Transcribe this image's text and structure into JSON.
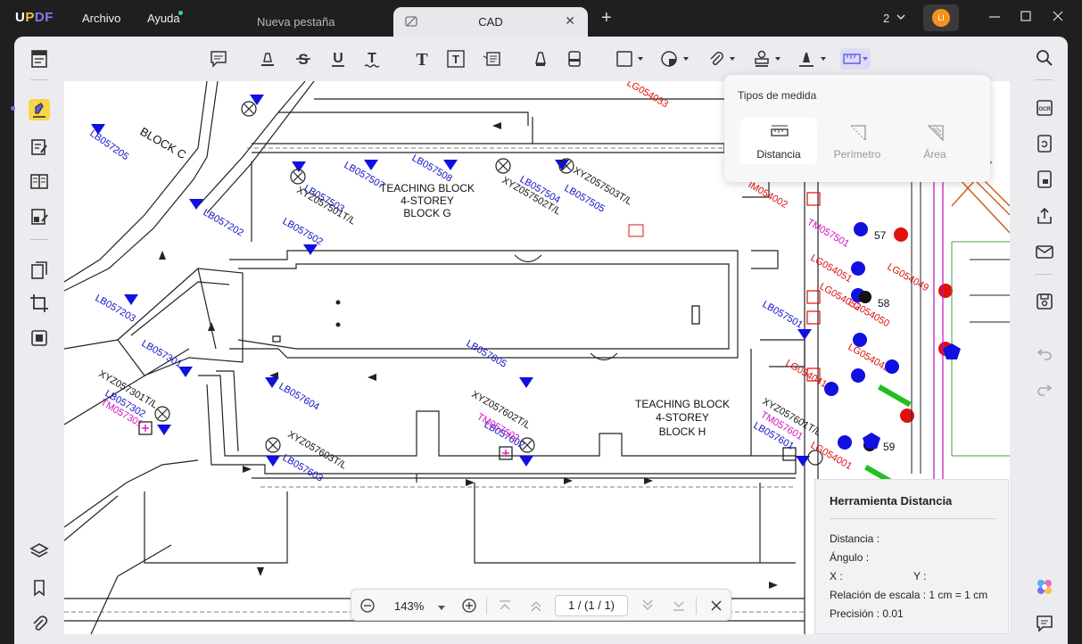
{
  "app": {
    "logo": "UPDF",
    "menu": [
      "Archivo",
      "Ayuda"
    ]
  },
  "tabs": {
    "inactive": "Nueva pestaña",
    "active": "CAD"
  },
  "window": {
    "page_count": "2",
    "avatar": "LI"
  },
  "measure_popup": {
    "title": "Tipos de medida",
    "options": [
      "Distancia",
      "Perímetro",
      "Área"
    ]
  },
  "distance_panel": {
    "title": "Herramienta Distancia",
    "distance": "Distancia :",
    "angle": "Ángulo :",
    "x": "X :",
    "y": "Y :",
    "scale": "Relación de escala : 1 cm = 1 cm",
    "precision": "Precisión : 0.01"
  },
  "zoom": {
    "level": "143%",
    "page": "1  /  (1 / 1)"
  },
  "drawing": {
    "block_c": "BLOCK C",
    "block_g": [
      "TEACHING BLOCK",
      "4-STOREY",
      "BLOCK G"
    ],
    "block_h": [
      "TEACHING BLOCK",
      "4-STOREY",
      "BLOCK H"
    ],
    "blue_labels": [
      "LB057205",
      "LB057202",
      "LB057203",
      "LB057301",
      "LB057302",
      "LB057502",
      "LB057503",
      "LB057507",
      "LB057508",
      "LB057504",
      "LB057505",
      "LB057605",
      "LB057604",
      "LB057603",
      "LB057602",
      "LB057601",
      "LB057501"
    ],
    "black_labels": [
      "XYZ057501T/L",
      "XYZ057502T/L",
      "XYZ057503T/L",
      "XYZ057301T/L",
      "XYZ057603T/L",
      "XYZ057602T/L",
      "XYZ057601T/L"
    ],
    "magenta_labels": [
      "TM057301",
      "TM057602",
      "TM057601",
      "TM057501"
    ],
    "red_labels": [
      "LG054033",
      "IM054002",
      "LG054051",
      "LG054052",
      "LG054049",
      "LG054042",
      "LG054041",
      "LG054001",
      "LG054050"
    ],
    "numbers": [
      "57",
      "58",
      "59"
    ]
  }
}
